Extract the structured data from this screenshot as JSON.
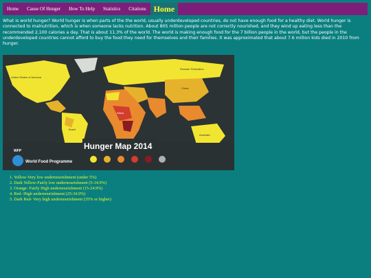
{
  "nav": {
    "items": [
      {
        "label": "Home"
      },
      {
        "label": "Cause Of Hunger"
      },
      {
        "label": "How To Help"
      },
      {
        "label": "Statistics"
      },
      {
        "label": "Citations"
      }
    ],
    "active_label": "Home"
  },
  "intro_text": "What is world hunger? World hunger is when parts of the the world, usually underdeveloped countries, do not have enough food for a healthy diet. World hunger is connected to malnutrition, which is when someone lacks nutrition. About 805 million people are not correctly nourished, and they wind up eating less than the recommended 2,100 calories a day. That is about 11.3% of the world. The world is making enough food for the 7 billion people in the world, but the people in the underdeveloped countries cannot afford to buy the food they need for themselves and their families. It was approximated that about 7.6 million kids died in 2010 from hunger.",
  "map": {
    "title": "Hunger Map 2014",
    "org_name": "World Food Programme",
    "org_acronym": "WFP",
    "regions": {
      "north_america": "United States of America",
      "south_america": "Brazil",
      "europe": "Russian Federation",
      "asia": "China",
      "africa_region": "Africa",
      "australia": "Australia"
    }
  },
  "legend": [
    {
      "text": "1. Yellow-Very low undernourishment (under 5%)"
    },
    {
      "text": "2. Dark Yellow-Fairly low undernourishment (5-14.9%)"
    },
    {
      "text": "3. Orange- Fairly High undernourishment (15-24.9%)"
    },
    {
      "text": "4. Red- High undernourishment (25-34.9%)"
    },
    {
      "text": "5. Dark Red- Very high undernourishment (35% or higher)"
    }
  ],
  "colors": {
    "background": "#0b7f7f",
    "navbar": "#7d1f7a",
    "active_tab": "#1c6f72",
    "active_text": "#ffff33",
    "legend_text": "#e6ff2a",
    "level_very_low": "#f2e531",
    "level_fairly_low": "#e7b22b",
    "level_fairly_high": "#e98a2e",
    "level_high": "#d23d2c",
    "level_very_high": "#8a1b22"
  }
}
